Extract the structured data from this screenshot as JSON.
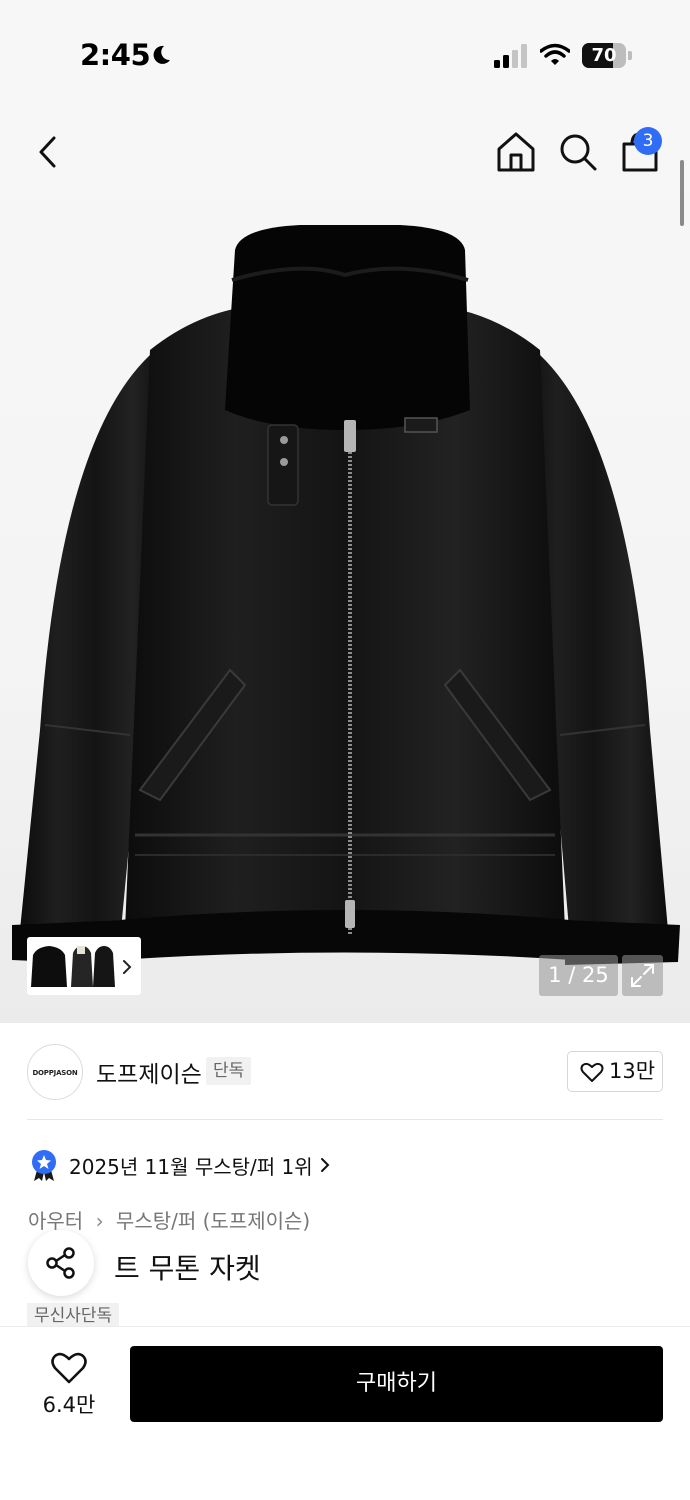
{
  "status_bar": {
    "time": "2:45",
    "battery": "70",
    "battery_level": 0.7,
    "icons": [
      "moon-icon",
      "signal-icon",
      "wifi-icon",
      "battery-icon"
    ]
  },
  "header": {
    "cart_count": "3",
    "icons": [
      "chevron-left-icon",
      "home-icon",
      "search-icon",
      "shopping-bag-icon"
    ]
  },
  "gallery": {
    "counter": "1 / 25",
    "icons": [
      "chevron-right-icon",
      "expand-icon"
    ]
  },
  "brand": {
    "logo_text": "DOPPJASON",
    "name": "도프제이슨",
    "tag": "단독",
    "like_count": "13만"
  },
  "ranking": {
    "text": "2025년 11월 무스탕/퍼 1위"
  },
  "breadcrumb": {
    "items": [
      "아우터",
      "무스탕/퍼 (도프제이슨)"
    ]
  },
  "product": {
    "title": "트 무톤 자켓",
    "exclusive_tag": "무신사단독"
  },
  "bottom_bar": {
    "like_count": "6.4만",
    "buy_label": "구매하기"
  },
  "colors": {
    "badge_blue": "#2f6df6",
    "buy_button": "#000000"
  }
}
